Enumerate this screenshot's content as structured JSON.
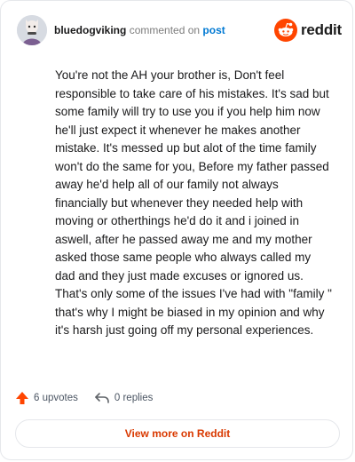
{
  "header": {
    "username": "bluedogviking",
    "commented_text": "commented on",
    "post_link": "post",
    "brand_wordmark": "reddit"
  },
  "comment": {
    "body": "You're not the AH your brother is, Don't feel responsible to take care of his mistakes. It's sad but some family will try to use you if you help him now he'll just expect it whenever he makes another mistake. It's messed up but alot of the time family won't do the same for you, Before my father passed away he'd help all of our family not always financially but whenever they needed help with moving or otherthings he'd do it and i joined in aswell, after he passed away me and my mother asked those same people who always called my dad and they just made excuses or ignored us. That's only some of the issues I've had with \"family \" that's why I might be biased in my opinion and why it's harsh just going off my personal experiences."
  },
  "actions": {
    "upvotes_label": "6 upvotes",
    "replies_label": "0 replies"
  },
  "footer": {
    "view_more_label": "View more on Reddit"
  },
  "colors": {
    "reddit_orange": "#FF4500",
    "link_blue": "#0079D3",
    "view_more_text": "#D93900",
    "border": "#E5E7EB"
  },
  "icons": {
    "avatar": "user-avatar",
    "brand": "reddit-snoo-icon",
    "upvote": "upvote-arrow-icon",
    "reply": "reply-arrow-icon"
  }
}
